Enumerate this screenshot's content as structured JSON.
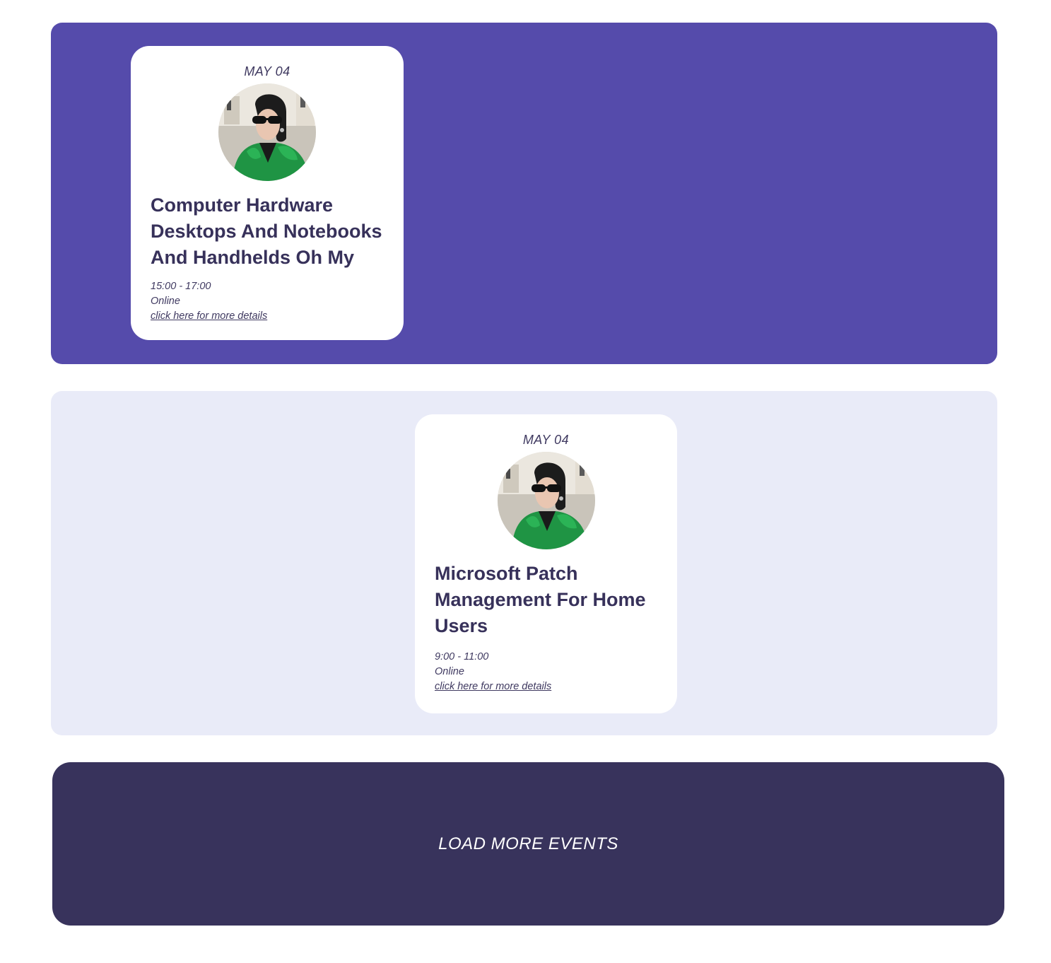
{
  "events": [
    {
      "date": "MAY 04",
      "title": "Computer Hardware Desktops And Notebooks And Handhelds Oh My",
      "time": "15:00 - 17:00",
      "location": "Online",
      "details_link": "click here for more details"
    },
    {
      "date": "MAY 04",
      "title": "Microsoft Patch Management For Home Users",
      "time": "9:00 - 11:00",
      "location": "Online",
      "details_link": "click here for more details"
    }
  ],
  "load_more_label": "LOAD MORE EVENTS",
  "colors": {
    "section_primary": "#554bab",
    "section_light": "#e9ebf8",
    "text_dark": "#37315a",
    "button_dark": "#38335c"
  }
}
